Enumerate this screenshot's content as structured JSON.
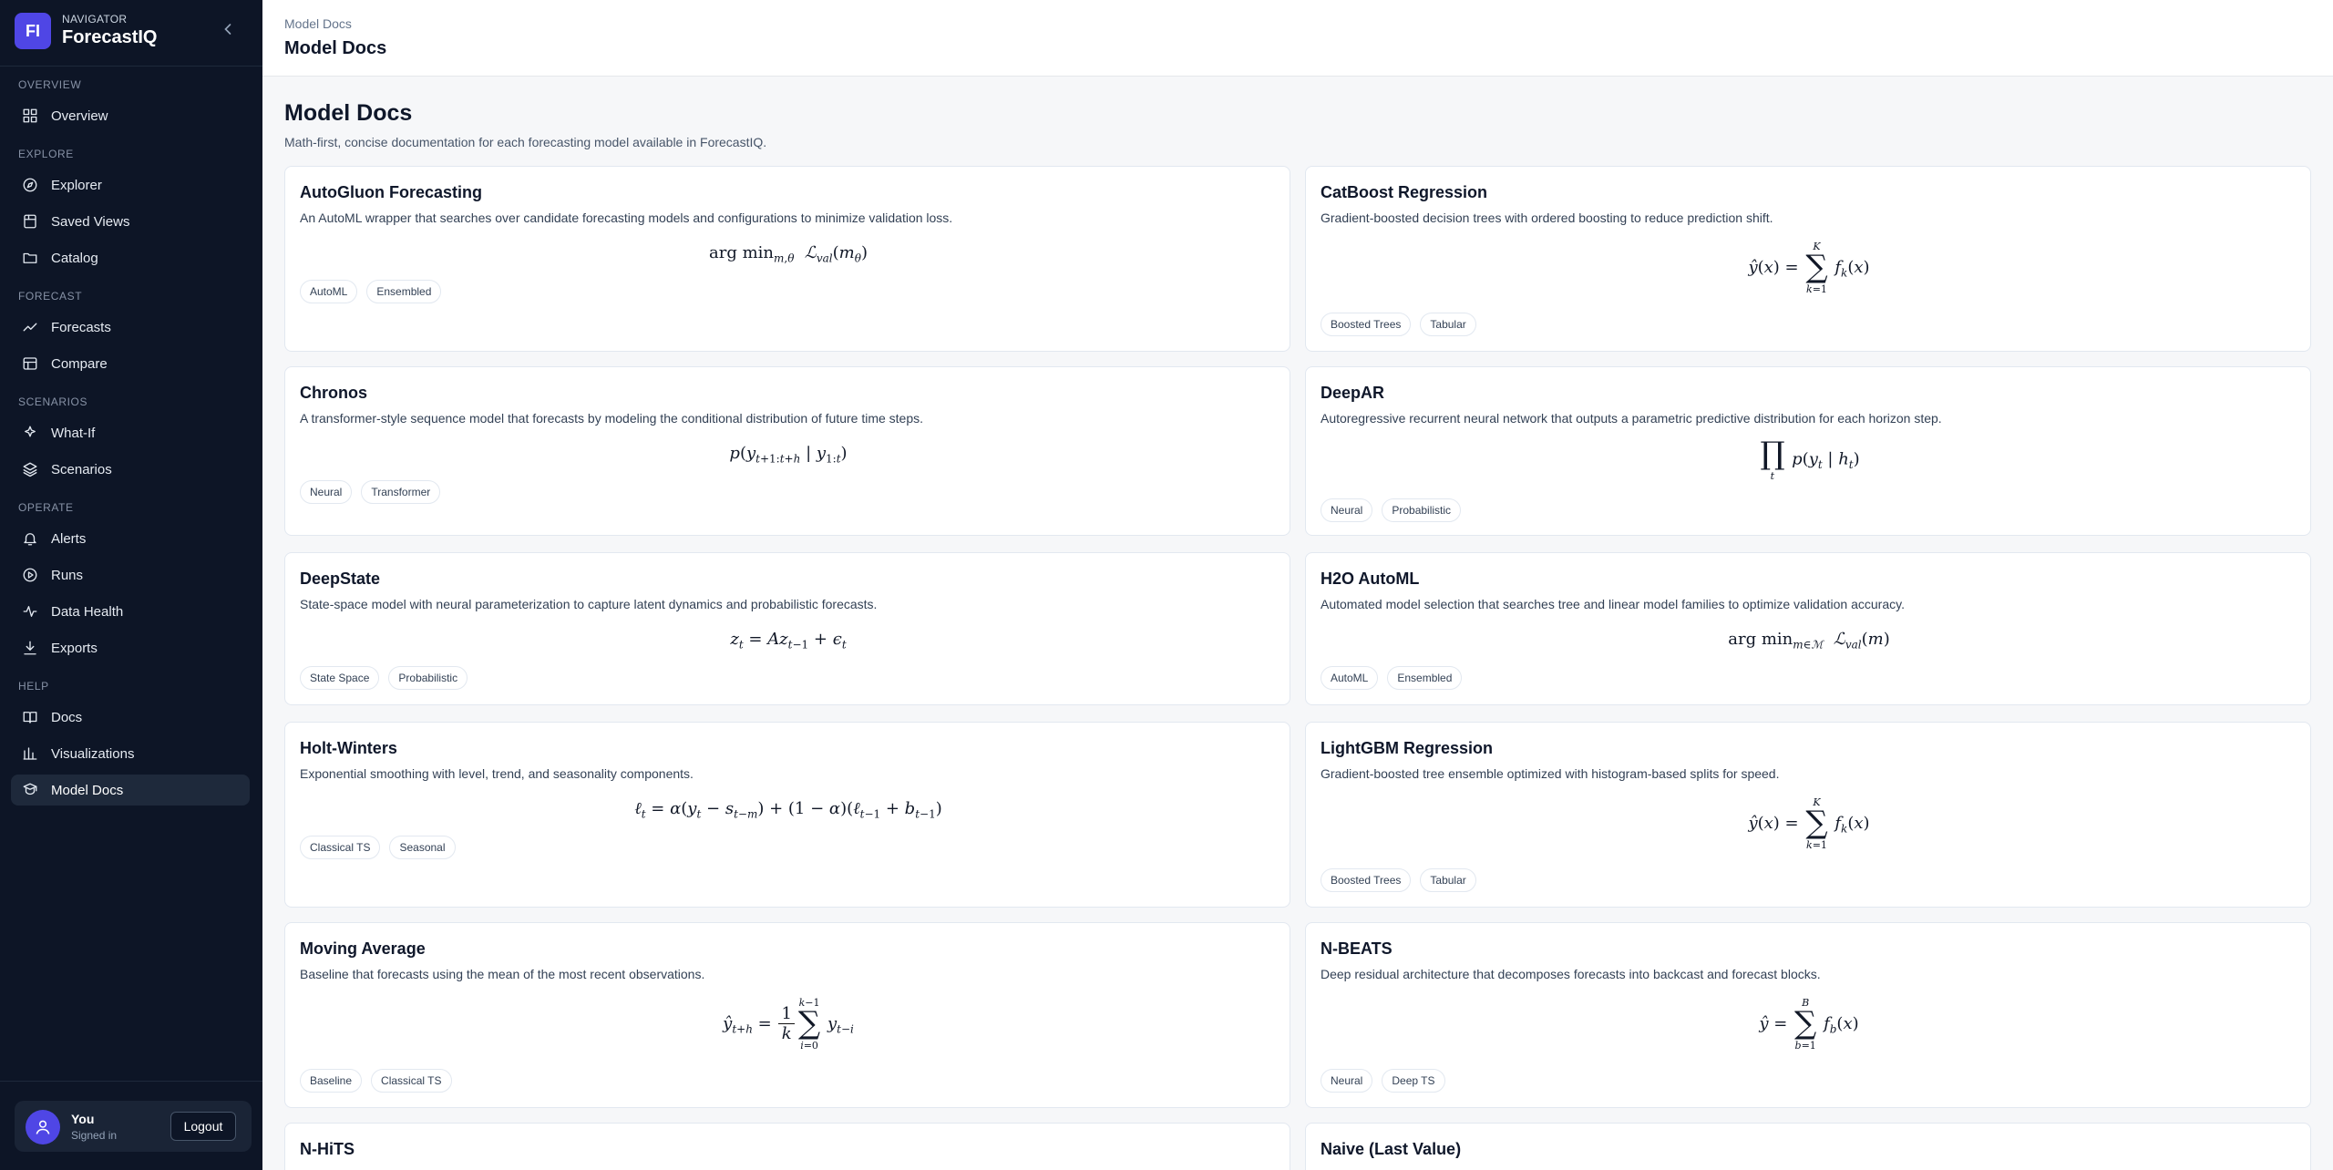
{
  "brand": {
    "logo": "FI",
    "kicker": "NAVIGATOR",
    "name": "ForecastIQ"
  },
  "sidebar": {
    "sections": [
      {
        "label": "OVERVIEW",
        "items": [
          {
            "label": "Overview",
            "icon": "grid-icon"
          }
        ]
      },
      {
        "label": "EXPLORE",
        "items": [
          {
            "label": "Explorer",
            "icon": "compass-icon"
          },
          {
            "label": "Saved Views",
            "icon": "bookmark-icon"
          },
          {
            "label": "Catalog",
            "icon": "folder-icon"
          }
        ]
      },
      {
        "label": "FORECAST",
        "items": [
          {
            "label": "Forecasts",
            "icon": "trend-icon"
          },
          {
            "label": "Compare",
            "icon": "columns-icon"
          }
        ]
      },
      {
        "label": "SCENARIOS",
        "items": [
          {
            "label": "What-If",
            "icon": "spark-icon"
          },
          {
            "label": "Scenarios",
            "icon": "layers-icon"
          }
        ]
      },
      {
        "label": "OPERATE",
        "items": [
          {
            "label": "Alerts",
            "icon": "bell-icon"
          },
          {
            "label": "Runs",
            "icon": "play-icon"
          },
          {
            "label": "Data Health",
            "icon": "pulse-icon"
          },
          {
            "label": "Exports",
            "icon": "download-icon"
          }
        ]
      },
      {
        "label": "HELP",
        "items": [
          {
            "label": "Docs",
            "icon": "book-icon"
          },
          {
            "label": "Visualizations",
            "icon": "bars-icon"
          },
          {
            "label": "Model Docs",
            "icon": "model-icon",
            "active": true
          }
        ]
      }
    ]
  },
  "user": {
    "name": "You",
    "status": "Signed in",
    "logout": "Logout"
  },
  "header": {
    "breadcrumb": "Model Docs",
    "title": "Model Docs"
  },
  "page": {
    "title": "Model Docs",
    "subtitle": "Math-first, concise documentation for each forecasting model available in ForecastIQ."
  },
  "models": [
    {
      "title": "AutoGluon Forecasting",
      "desc": "An AutoML wrapper that searches over candidate forecasting models and configurations to minimize validation loss.",
      "tags": [
        "AutoML",
        "Ensembled"
      ]
    },
    {
      "title": "CatBoost Regression",
      "desc": "Gradient-boosted decision trees with ordered boosting to reduce prediction shift.",
      "tags": [
        "Boosted Trees",
        "Tabular"
      ]
    },
    {
      "title": "Chronos",
      "desc": "A transformer-style sequence model that forecasts by modeling the conditional distribution of future time steps.",
      "tags": [
        "Neural",
        "Transformer"
      ]
    },
    {
      "title": "DeepAR",
      "desc": "Autoregressive recurrent neural network that outputs a parametric predictive distribution for each horizon step.",
      "tags": [
        "Neural",
        "Probabilistic"
      ]
    },
    {
      "title": "DeepState",
      "desc": "State-space model with neural parameterization to capture latent dynamics and probabilistic forecasts.",
      "tags": [
        "State Space",
        "Probabilistic"
      ]
    },
    {
      "title": "H2O AutoML",
      "desc": "Automated model selection that searches tree and linear model families to optimize validation accuracy.",
      "tags": [
        "AutoML",
        "Ensembled"
      ]
    },
    {
      "title": "Holt-Winters",
      "desc": "Exponential smoothing with level, trend, and seasonality components.",
      "tags": [
        "Classical TS",
        "Seasonal"
      ]
    },
    {
      "title": "LightGBM Regression",
      "desc": "Gradient-boosted tree ensemble optimized with histogram-based splits for speed.",
      "tags": [
        "Boosted Trees",
        "Tabular"
      ]
    },
    {
      "title": "Moving Average",
      "desc": "Baseline that forecasts using the mean of the most recent observations.",
      "tags": [
        "Baseline",
        "Classical TS"
      ]
    },
    {
      "title": "N-BEATS",
      "desc": "Deep residual architecture that decomposes forecasts into backcast and forecast blocks.",
      "tags": [
        "Neural",
        "Deep TS"
      ]
    },
    {
      "title": "N-HiTS"
    },
    {
      "title": "Naive (Last Value)"
    }
  ]
}
